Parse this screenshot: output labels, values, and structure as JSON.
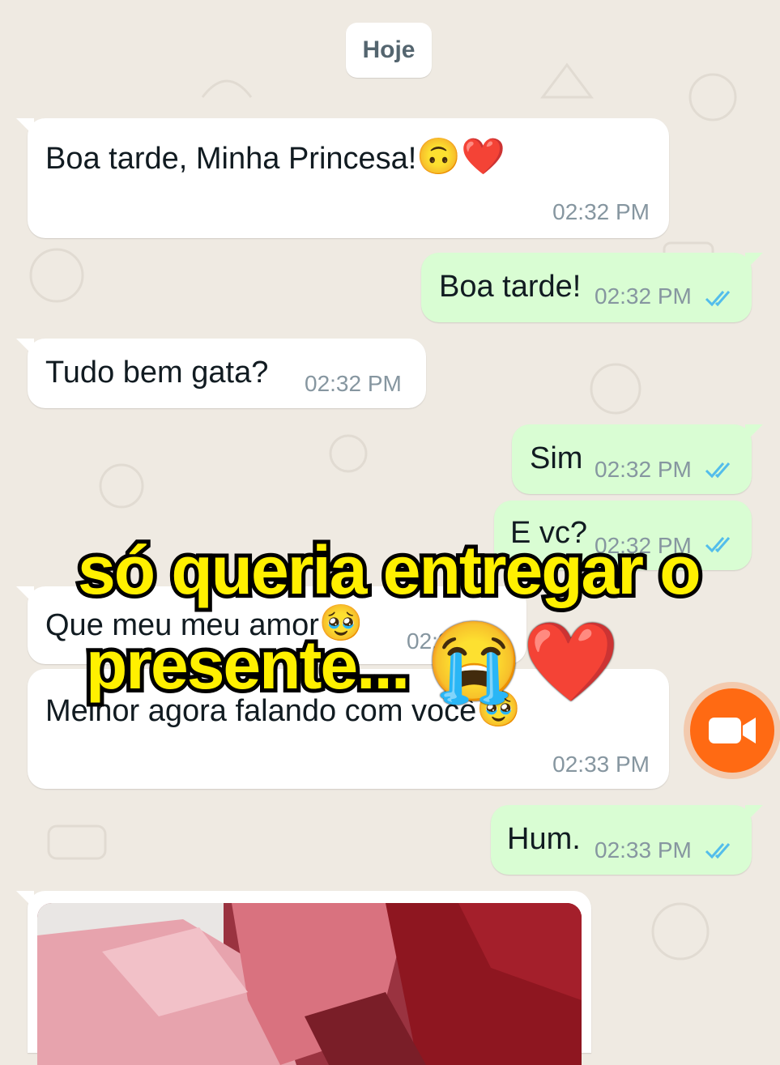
{
  "date_chip": "Hoje",
  "messages": [
    {
      "id": "m1",
      "dir": "in",
      "text": "Boa tarde, Minha Princesa!",
      "emoji": "🙃❤️",
      "time": "02:32 PM"
    },
    {
      "id": "m2",
      "dir": "out",
      "text": "Boa tarde!",
      "time": "02:32 PM",
      "status": "read"
    },
    {
      "id": "m3",
      "dir": "in",
      "text": "Tudo bem gata?",
      "time": "02:32 PM"
    },
    {
      "id": "m4",
      "dir": "out",
      "text": "Sim",
      "time": "02:32 PM",
      "status": "read"
    },
    {
      "id": "m5",
      "dir": "out",
      "text": "E vc?",
      "time": "02:32 PM",
      "status": "read"
    },
    {
      "id": "m6",
      "dir": "in",
      "text": "Que meu meu amor",
      "emoji": "🥹",
      "time": "02:3"
    },
    {
      "id": "m7",
      "dir": "in",
      "text": "Melhor agora falando com você",
      "emoji": "🥹",
      "time": "02:33 PM"
    },
    {
      "id": "m8",
      "dir": "out",
      "text": "Hum.",
      "time": "02:33 PM",
      "status": "read"
    },
    {
      "id": "m9",
      "dir": "in",
      "type": "image",
      "description": "photo-message"
    }
  ],
  "overlay": {
    "line1": "só queria entregar o",
    "line2": "presente...",
    "emoji": "😭❤️"
  },
  "colors": {
    "background": "#efeae2",
    "incoming": "#ffffff",
    "outgoing": "#d9fdd3",
    "read_ticks": "#53bdeb",
    "overlay_text": "#fff000",
    "video_button": "#ff6a13"
  },
  "icons": {
    "read_receipt": "double-check-icon",
    "video_call": "video-camera-icon"
  }
}
